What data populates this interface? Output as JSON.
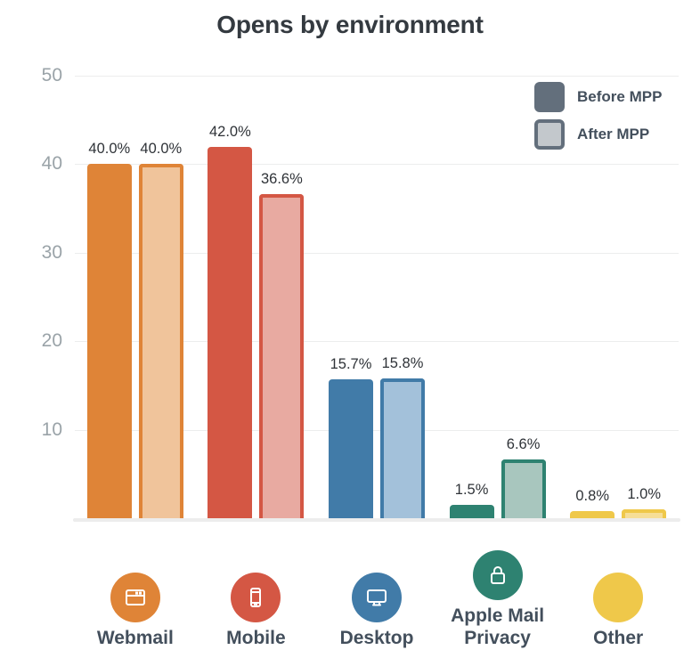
{
  "chart_data": {
    "type": "bar",
    "title": "Opens by environment",
    "xlabel": "",
    "ylabel": "",
    "ylim": [
      0,
      50
    ],
    "yticks": [
      50,
      40,
      30,
      20,
      10
    ],
    "grid": true,
    "legend_position": "top-right",
    "categories": [
      "Webmail",
      "Mobile",
      "Desktop",
      "Apple Mail Privacy",
      "Other"
    ],
    "series": [
      {
        "name": "Before MPP",
        "values": [
          40.0,
          42.0,
          15.7,
          1.5,
          0.8
        ],
        "labels": [
          "40.0%",
          "42.0%",
          "15.7%",
          "1.5%",
          "0.8%"
        ]
      },
      {
        "name": "After MPP",
        "values": [
          40.0,
          36.6,
          15.8,
          6.6,
          1.0
        ],
        "labels": [
          "40.0%",
          "36.6%",
          "15.8%",
          "6.6%",
          "1.0%"
        ]
      }
    ],
    "category_colors": [
      "#df8437",
      "#d45744",
      "#417ba8",
      "#2e8271",
      "#efc84a"
    ],
    "category_colors_light": [
      "#f0c49b",
      "#e8aaa1",
      "#a3c1da",
      "#a8c6be",
      "#f6de97"
    ],
    "category_icons": [
      "browser-window-icon",
      "mobile-phone-icon",
      "desktop-monitor-icon",
      "padlock-icon",
      "blank-circle-icon"
    ]
  },
  "legend": {
    "items": [
      {
        "label": "Before MPP",
        "style": "solid"
      },
      {
        "label": "After MPP",
        "style": "outlined"
      }
    ]
  },
  "colors": {
    "title": "#343a40",
    "tick": "#9aa3a8",
    "category_label": "#434f5c",
    "data_label": "#2f3338",
    "gridline": "#eceded",
    "legend_swatch_before": "#636f7c",
    "legend_swatch_after_fill": "#c3c8cc",
    "legend_swatch_after_border": "#636f7c"
  }
}
